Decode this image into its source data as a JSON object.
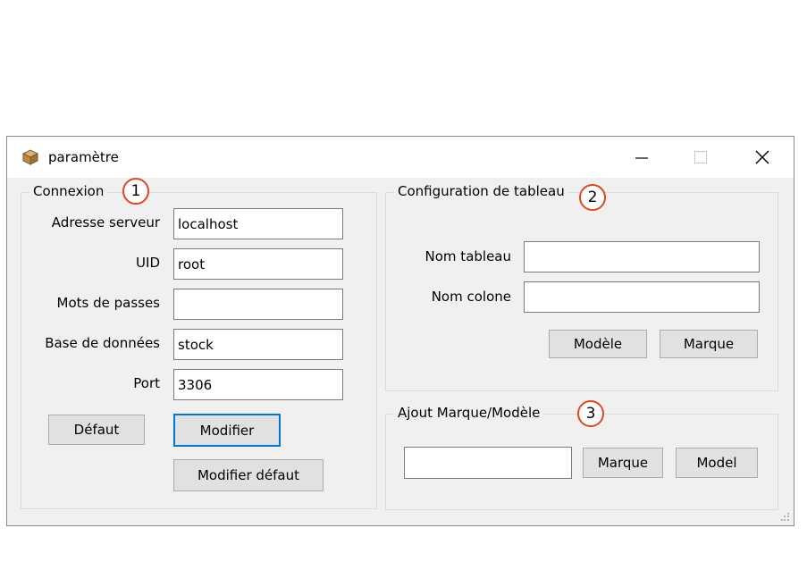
{
  "window": {
    "title": "paramètre",
    "controls": {
      "minimize": "—",
      "maximize": "☐",
      "close": "✕"
    }
  },
  "connexion": {
    "title": "Connexion",
    "badge": "1",
    "fields": [
      {
        "label": "Adresse serveur",
        "value": "localhost"
      },
      {
        "label": "UID",
        "value": "root"
      },
      {
        "label": "Mots de passes",
        "value": ""
      },
      {
        "label": "Base de données",
        "value": "stock"
      },
      {
        "label": "Port",
        "value": "3306"
      }
    ],
    "buttons": {
      "default": "Défaut",
      "modify": "Modifier",
      "modify_default": "Modifier défaut"
    }
  },
  "config": {
    "title": "Configuration de tableau",
    "badge": "2",
    "fields": [
      {
        "label": "Nom tableau",
        "value": ""
      },
      {
        "label": "Nom colone",
        "value": ""
      }
    ],
    "buttons": {
      "model": "Modèle",
      "brand": "Marque"
    }
  },
  "ajout": {
    "title": "Ajout Marque/Modèle",
    "badge": "3",
    "input_value": "",
    "buttons": {
      "brand": "Marque",
      "model": "Model"
    }
  },
  "colors": {
    "badge_border": "#e0481b",
    "focus_border": "#0078d7",
    "window_bg": "#f0f0f0"
  }
}
